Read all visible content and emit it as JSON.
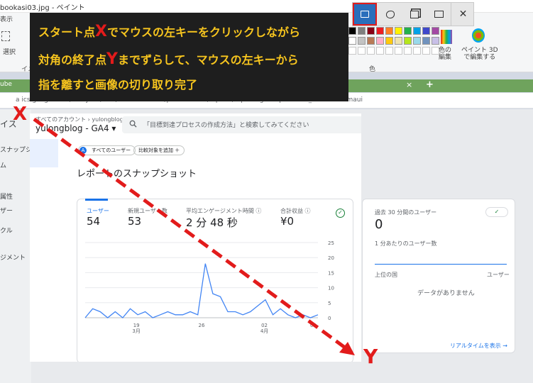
{
  "paint": {
    "window_title": "bookasi03.jpg - ペイント",
    "menu_view": "表示",
    "tool_select": "選択",
    "tool_image_group": "イメ",
    "palette_label": "色",
    "edit_colors": "色の\n編集",
    "paint3d": "ペイント 3D\nで編集する",
    "palette_colors": [
      "#000000",
      "#7f7f7f",
      "#880015",
      "#ed1c24",
      "#ff7f27",
      "#fff200",
      "#22b14c",
      "#00a2e8",
      "#3f48cc",
      "#a349a4",
      "#ffffff",
      "#c3c3c3",
      "#b97a57",
      "#ffaec9",
      "#ffc90e",
      "#efe4b0",
      "#b5e61d",
      "#99d9ea",
      "#7092be",
      "#c8bfe7"
    ]
  },
  "browser": {
    "tab_label": "ube",
    "tab_close": "×",
    "new_tab": "+",
    "url": "a   ics.google.com/analytics/web/?authuser=0#/p354376488/reports/reportinghub?params=_u..nav%3Dmaui"
  },
  "snip_toolbar": {
    "rect_icon": "rect-snip-icon",
    "freeform_icon": "freeform-snip-icon",
    "window_icon": "window-snip-icon",
    "fullscreen_icon": "fullscreen-snip-icon",
    "close": "✕"
  },
  "instruction": {
    "line1_pre": "スタート点",
    "line1_letter": "X",
    "line1_post": "でマウスの左キーをクリックしながら",
    "line2_pre": "対角の終了点",
    "line2_letter": "Y",
    "line2_post": "までずらして、マウスの左キーから",
    "line3": "指を離すと画像の切り取り完了"
  },
  "markers": {
    "start": "X",
    "end": "Y"
  },
  "ga": {
    "left_nav": [
      "イス",
      "スナップショット",
      "ム",
      "属性",
      "ザー",
      "クル",
      "ジメント"
    ],
    "breadcrumb": "すべてのアカウント › yulongblog",
    "property": "yulongblog - GA4 ▾",
    "search_placeholder": "「目標到達プロセスの作成方法」と検索してみてください",
    "chip_all_users": "すべてのユーザー",
    "chip_all_badge": "A",
    "chip_compare": "比較対象を追加 ＋",
    "page_title": "レポートのスナップショット",
    "metrics": [
      {
        "label": "ユーザー",
        "value": "54"
      },
      {
        "label": "新規ユーザー数",
        "value": "53"
      },
      {
        "label": "平均エンゲージメント時間 ⓘ",
        "value": "2 分 48 秒"
      },
      {
        "label": "合計収益 ⓘ",
        "value": "¥0"
      }
    ],
    "check_icon": "✓",
    "realtime": {
      "title": "過去 30 分間のユーザー",
      "value": "0",
      "per_minute": "1 分あたりのユーザー数",
      "col_country": "上位の国",
      "col_users": "ユーザー",
      "no_data": "データがありません",
      "link": "リアルタイムを表示 →"
    }
  },
  "chart_data": {
    "type": "line",
    "x_tick_labels": [
      "19\n3月",
      "26",
      "02\n4月",
      "09"
    ],
    "y_ticks": [
      0,
      5,
      10,
      15,
      20,
      25
    ],
    "ylim": [
      0,
      25
    ],
    "series": [
      {
        "values": [
          0,
          3,
          2,
          0,
          2,
          0,
          3,
          1,
          2,
          0,
          1,
          2,
          1,
          1,
          2,
          1,
          18,
          8,
          7,
          2,
          2,
          1,
          2,
          4,
          6,
          1,
          3,
          1,
          0,
          1,
          0,
          1
        ]
      }
    ],
    "grid": true
  }
}
